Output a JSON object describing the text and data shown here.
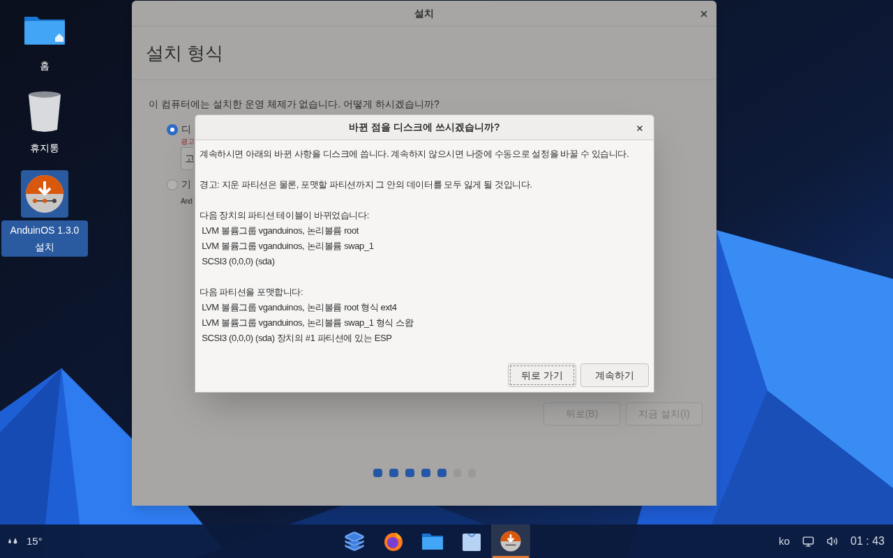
{
  "desktop_icons": [
    {
      "kind": "home",
      "label": "홈",
      "selected": false
    },
    {
      "kind": "trash",
      "label": "휴지통",
      "selected": false
    },
    {
      "kind": "installer",
      "label": "AnduinOS 1.3.0 설치",
      "selected": true
    }
  ],
  "window": {
    "title": "설치",
    "heading": "설치 형식",
    "question": "이 컴퓨터에는 설치한 운영 체제가 없습니다. 어떻게 하시겠습니까?",
    "options": [
      {
        "label": "디",
        "selected": true,
        "warning": "경고",
        "button": "고"
      },
      {
        "label": "기",
        "selected": false,
        "description": "And"
      }
    ],
    "buttons": [
      {
        "label": "뒤로(B)",
        "disabled": true
      },
      {
        "label": "지금 설치(I)",
        "disabled": true
      }
    ],
    "steps": [
      {
        "done": true
      },
      {
        "done": true
      },
      {
        "done": true
      },
      {
        "done": true
      },
      {
        "done": true
      },
      {
        "done": false
      },
      {
        "done": false
      }
    ]
  },
  "dialog": {
    "title": "바뀐 점을 디스크에 쓰시겠습니까?",
    "paragraphs": [
      [
        "계속하시면 아래의 바뀐 사항을 디스크에 씁니다. 계속하지 않으시면 나중에 수동으로 설정을 바꿀 수 있습니다."
      ],
      [
        "경고: 지운 파티션은 물론, 포맷할 파티션까지 그 안의 데이터를 모두 잃게 될 것입니다."
      ],
      [
        "다음 장치의 파티션 테이블이 바뀌었습니다:",
        " LVM 볼륨그룹 vganduinos, 논리볼륨 root",
        " LVM 볼륨그룹 vganduinos, 논리볼륨 swap_1",
        " SCSI3 (0,0,0) (sda)"
      ],
      [
        "다음 파티션을 포맷합니다:",
        " LVM 볼륨그룹 vganduinos, 논리볼륨 root 형식 ext4",
        " LVM 볼륨그룹 vganduinos, 논리볼륨 swap_1 형식 스왑",
        " SCSI3 (0,0,0) (sda) 장치의 #1 파티션에 있는 ESP"
      ]
    ],
    "buttons": [
      {
        "label": "뒤로 가기",
        "focused": true
      },
      {
        "label": "계속하기",
        "focused": false
      }
    ]
  },
  "taskbar": {
    "weather": "15°",
    "apps": [
      {
        "kind": "layers",
        "active": false
      },
      {
        "kind": "browser",
        "active": false
      },
      {
        "kind": "files",
        "active": false
      },
      {
        "kind": "store",
        "active": false
      },
      {
        "kind": "installer",
        "active": true
      }
    ],
    "language": "ko",
    "clock": "01 : 43"
  }
}
